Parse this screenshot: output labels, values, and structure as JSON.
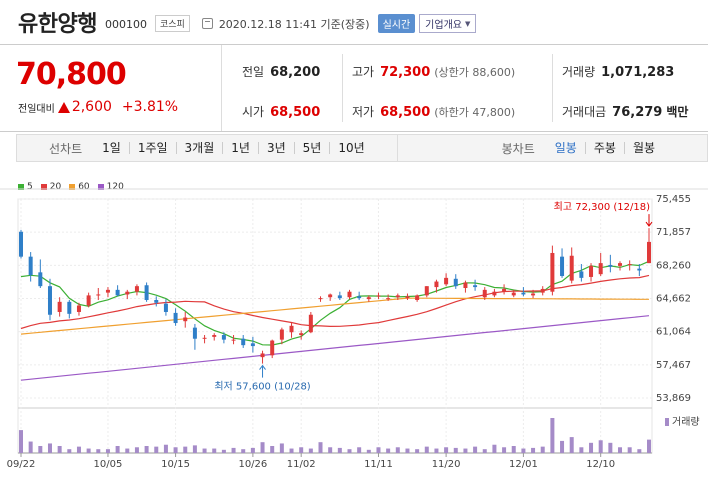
{
  "header": {
    "stock_name": "유한양행",
    "stock_code": "000100",
    "market": "코스피",
    "date_time": "2020.12.18 11:41 기준(장중)",
    "realtime_label": "실시간",
    "company_info_label": "기업개요"
  },
  "price": {
    "current": "70,800",
    "change_label": "전일대비",
    "change_amount": "2,600",
    "change_percent": "+3.81%",
    "up_color": "#dd0000"
  },
  "quotes": {
    "prev_label": "전일",
    "prev_value": "68,200",
    "high_label": "고가",
    "high_value": "72,300",
    "upper_limit": "(상한가 88,600)",
    "volume_label": "거래량",
    "volume_value": "1,071,283",
    "open_label": "시가",
    "open_value": "68,500",
    "low_label": "저가",
    "low_value": "68,500",
    "lower_limit": "(하한가 47,800)",
    "amount_label": "거래대금",
    "amount_value": "76,279",
    "amount_unit": "백만"
  },
  "period_bar": {
    "line_label": "선차트",
    "line_options": [
      "1일",
      "1주일",
      "3개월",
      "1년",
      "3년",
      "5년",
      "10년"
    ],
    "candle_label": "봉차트",
    "candle_options": [
      "일봉",
      "주봉",
      "월봉"
    ],
    "candle_selected": 0
  },
  "chart_data": {
    "type": "candlestick",
    "legend": [
      {
        "name": "5",
        "color": "#3cb034"
      },
      {
        "name": "20",
        "color": "#e03a3a"
      },
      {
        "name": "60",
        "color": "#f0a030"
      },
      {
        "name": "120",
        "color": "#9b59c6"
      }
    ],
    "y_ticks": [
      "75,455",
      "71,857",
      "68,260",
      "64,662",
      "61,064",
      "57,467",
      "53,869"
    ],
    "ylim": [
      53869,
      75455
    ],
    "x_ticks": [
      "09/22",
      "10/05",
      "10/15",
      "10/26",
      "11/02",
      "11/11",
      "11/20",
      "12/01",
      "12/10"
    ],
    "x_tick_index": [
      0,
      9,
      16,
      24,
      29,
      37,
      44,
      52,
      60
    ],
    "up_color": "#e03a3a",
    "down_color": "#2f7fc8",
    "high_annotation": "최고 72,300 (12/18)",
    "low_annotation": "최저 57,600 (10/28)",
    "high_index": 65,
    "low_index": 25,
    "volume_label": "거래량",
    "candles": [
      [
        71900,
        72100,
        69000,
        69200
      ],
      [
        69200,
        69700,
        66500,
        67200
      ],
      [
        67500,
        68900,
        65800,
        66000
      ],
      [
        66000,
        66800,
        62300,
        62900
      ],
      [
        63200,
        64800,
        62700,
        64300
      ],
      [
        64300,
        64500,
        62500,
        63000
      ],
      [
        63200,
        64200,
        62800,
        63900
      ],
      [
        63900,
        65300,
        63700,
        65000
      ],
      [
        65000,
        65800,
        64500,
        65100
      ],
      [
        65300,
        65900,
        64800,
        65600
      ],
      [
        65600,
        66100,
        64900,
        65000
      ],
      [
        65100,
        65600,
        64600,
        65400
      ],
      [
        65400,
        66200,
        65000,
        66000
      ],
      [
        66100,
        66400,
        64300,
        64500
      ],
      [
        64500,
        64900,
        63800,
        64200
      ],
      [
        64100,
        64600,
        62800,
        63200
      ],
      [
        63100,
        63600,
        61700,
        62000
      ],
      [
        62200,
        63200,
        61500,
        62600
      ],
      [
        61500,
        61900,
        59100,
        60300
      ],
      [
        60300,
        60700,
        59800,
        60400
      ],
      [
        60500,
        60900,
        60100,
        60700
      ],
      [
        60700,
        61000,
        59800,
        60200
      ],
      [
        60200,
        60700,
        59700,
        60200
      ],
      [
        60300,
        60700,
        59300,
        59600
      ],
      [
        59800,
        60500,
        58800,
        59500
      ],
      [
        58300,
        59000,
        57600,
        58700
      ],
      [
        58500,
        60200,
        58200,
        60100
      ],
      [
        60200,
        61500,
        59700,
        61300
      ],
      [
        61000,
        62000,
        60400,
        61700
      ],
      [
        60700,
        61200,
        60200,
        60900
      ],
      [
        61000,
        63200,
        60900,
        62900
      ],
      [
        64600,
        64900,
        64300,
        64700
      ],
      [
        64800,
        65200,
        64400,
        65100
      ],
      [
        65000,
        65400,
        64500,
        64700
      ],
      [
        64800,
        65600,
        64600,
        65400
      ],
      [
        64900,
        65400,
        64500,
        64700
      ],
      [
        64600,
        65000,
        64300,
        64800
      ],
      [
        64900,
        65300,
        64600,
        65000
      ],
      [
        64700,
        65100,
        64400,
        64700
      ],
      [
        64800,
        65200,
        64500,
        65000
      ],
      [
        64700,
        65200,
        64500,
        64900
      ],
      [
        64500,
        65100,
        64300,
        65000
      ],
      [
        65000,
        66000,
        64800,
        66000
      ],
      [
        65900,
        66700,
        65300,
        66500
      ],
      [
        66200,
        67400,
        66000,
        66900
      ],
      [
        66800,
        67300,
        65700,
        66000
      ],
      [
        65800,
        66600,
        65300,
        66400
      ],
      [
        66100,
        66700,
        65500,
        65900
      ],
      [
        64800,
        65900,
        64500,
        65600
      ],
      [
        65000,
        65700,
        64800,
        65400
      ],
      [
        65400,
        66200,
        65100,
        65700
      ],
      [
        65000,
        65600,
        64800,
        65300
      ],
      [
        65300,
        65900,
        64900,
        65100
      ],
      [
        65000,
        65600,
        64700,
        65200
      ],
      [
        65300,
        66000,
        65000,
        65700
      ],
      [
        65400,
        70400,
        65000,
        69600
      ],
      [
        69200,
        70100,
        66900,
        67100
      ],
      [
        66600,
        70200,
        66300,
        69300
      ],
      [
        67600,
        68400,
        66500,
        66900
      ],
      [
        67000,
        68500,
        66500,
        68200
      ],
      [
        67300,
        69600,
        67100,
        68500
      ],
      [
        68300,
        69400,
        67500,
        68100
      ],
      [
        68200,
        68700,
        67700,
        68500
      ],
      [
        68300,
        68800,
        67700,
        68400
      ],
      [
        67900,
        68400,
        67100,
        67700
      ],
      [
        68500,
        72300,
        68500,
        70800
      ]
    ],
    "volumes": [
      360,
      180,
      110,
      150,
      110,
      60,
      100,
      70,
      60,
      60,
      110,
      70,
      90,
      110,
      100,
      130,
      90,
      100,
      120,
      70,
      70,
      50,
      80,
      60,
      80,
      170,
      110,
      150,
      70,
      90,
      70,
      170,
      90,
      80,
      60,
      90,
      50,
      90,
      70,
      90,
      70,
      60,
      100,
      70,
      90,
      80,
      70,
      100,
      60,
      130,
      90,
      110,
      70,
      80,
      100,
      550,
      190,
      250,
      90,
      160,
      200,
      160,
      90,
      90,
      60,
      210
    ]
  }
}
